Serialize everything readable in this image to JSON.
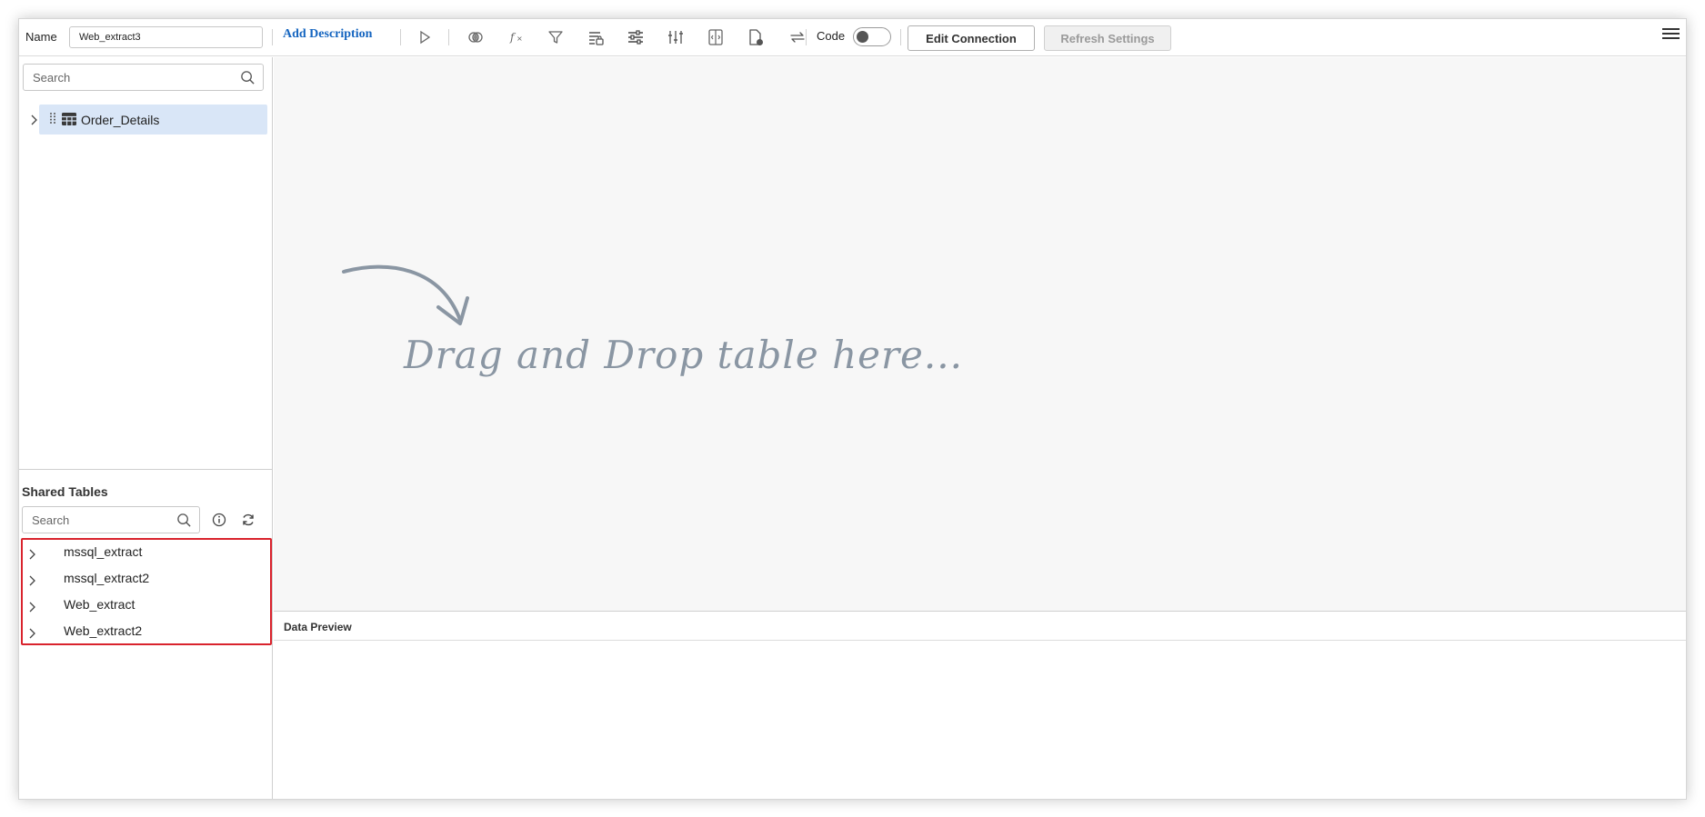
{
  "toolbar": {
    "name_label": "Name",
    "name_value": "Web_extract3",
    "add_description": "Add Description",
    "code_label": "Code",
    "code_enabled": false,
    "edit_connection": "Edit Connection",
    "refresh_settings": "Refresh Settings",
    "icons": [
      "run-icon",
      "join-icon",
      "formula-icon",
      "filter-icon",
      "sort-icon",
      "settings-sliders-icon",
      "column-adjust-icon",
      "split-column-icon",
      "file-status-icon",
      "swap-icon",
      "menu-icon"
    ]
  },
  "tables_panel": {
    "search_placeholder": "Search",
    "tables": [
      {
        "label": "Order_Details"
      }
    ]
  },
  "shared_tables": {
    "title": "Shared Tables",
    "search_placeholder": "Search",
    "items": [
      {
        "label": "mssql_extract"
      },
      {
        "label": "mssql_extract2"
      },
      {
        "label": "Web_extract"
      },
      {
        "label": "Web_extract2"
      }
    ]
  },
  "canvas": {
    "drop_hint": "Drag and Drop table here..."
  },
  "data_preview": {
    "title": "Data Preview"
  },
  "colors": {
    "accent_link": "#1565c0",
    "selection": "#d9e6f7",
    "highlight_border": "#d9232d",
    "hint_text": "#8a96a3"
  }
}
